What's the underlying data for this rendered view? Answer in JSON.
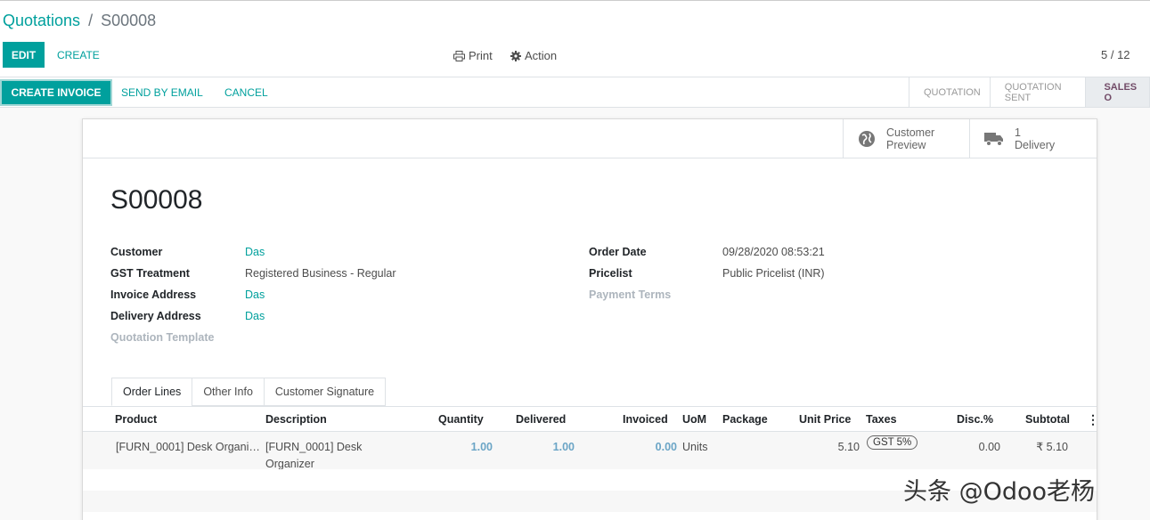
{
  "breadcrumb": {
    "parent": "Quotations",
    "separator": "/",
    "current": "S00008"
  },
  "toolbar": {
    "edit": "EDIT",
    "create": "CREATE",
    "print": "Print",
    "action": "Action",
    "pager": "5 / 12"
  },
  "statusbar": {
    "buttons": [
      "CREATE INVOICE",
      "SEND BY EMAIL",
      "CANCEL"
    ],
    "stages": [
      "QUOTATION",
      "QUOTATION SENT",
      "SALES O"
    ]
  },
  "smart_buttons": {
    "preview": {
      "line1": "Customer",
      "line2": "Preview",
      "icon": "globe-icon"
    },
    "delivery": {
      "line1": "1",
      "line2": "Delivery",
      "icon": "truck-icon"
    }
  },
  "record": {
    "name": "S00008",
    "left_fields": [
      {
        "label": "Customer",
        "value": "Das"
      },
      {
        "label": "GST Treatment",
        "value": "Registered Business - Regular"
      },
      {
        "label": "Invoice Address",
        "value": "Das"
      },
      {
        "label": "Delivery Address",
        "value": "Das"
      },
      {
        "label": "Quotation Template",
        "value": ""
      }
    ],
    "right_fields": [
      {
        "label": "Order Date",
        "value": "09/28/2020 08:53:21"
      },
      {
        "label": "Pricelist",
        "value": "Public Pricelist (INR)"
      },
      {
        "label": "Payment Terms",
        "value": ""
      }
    ]
  },
  "tabs": [
    "Order Lines",
    "Other Info",
    "Customer Signature"
  ],
  "order_lines": {
    "columns": [
      "Product",
      "Description",
      "Quantity",
      "Delivered",
      "Invoiced",
      "UoM",
      "Package",
      "Unit Price",
      "Taxes",
      "Disc.%",
      "Subtotal"
    ],
    "rows": [
      {
        "product": "[FURN_0001] Desk Organi…",
        "description_1": "[FURN_0001] Desk",
        "description_2": "Organizer",
        "quantity": "1.00",
        "delivered": "1.00",
        "invoiced": "0.00",
        "uom": "Units",
        "unit_price": "5.10",
        "tax": "GST 5%",
        "discount": "0.00",
        "subtotal": "₹ 5.10"
      }
    ]
  },
  "watermark": "头条 @Odoo老杨",
  "colors": {
    "primary": "#00a09d",
    "stage_active": "#714B67"
  }
}
